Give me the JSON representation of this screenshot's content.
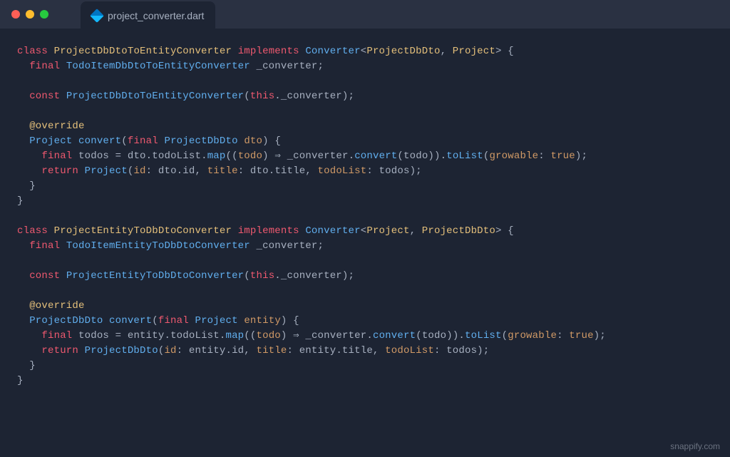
{
  "titlebar": {
    "filename": "project_converter.dart"
  },
  "code": {
    "line1_class": "class",
    "line1_name": "ProjectDbDtoToEntityConverter",
    "line1_impl": "implements",
    "line1_conv": "Converter",
    "line1_t1": "ProjectDbDto",
    "line1_t2": "Project",
    "line2_final": "final",
    "line2_type": "TodoItemDbDtoToEntityConverter",
    "line2_name": "_converter",
    "line4_const": "const",
    "line4_name": "ProjectDbDtoToEntityConverter",
    "line4_this": "this",
    "line4_field": "._converter",
    "line6_anno": "@override",
    "line7_ret": "Project",
    "line7_method": "convert",
    "line7_final": "final",
    "line7_ptype": "ProjectDbDto",
    "line7_pname": "dto",
    "line8_final": "final",
    "line8_var": "todos",
    "line8_dto": "dto",
    "line8_todolist": ".todoList.",
    "line8_map": "map",
    "line8_todo": "todo",
    "line8_arrow": "⇒",
    "line8_conv": "_converter.",
    "line8_convert": "convert",
    "line8_tolist": "toList",
    "line8_grow": "growable",
    "line8_true": "true",
    "line9_return": "return",
    "line9_proj": "Project",
    "line9_id": "id",
    "line9_dtoid": " dto.id, ",
    "line9_title": "title",
    "line9_dtotitle": " dto.title, ",
    "line9_todolist": "todoList",
    "line9_todos": " todos",
    "class2_name": "ProjectEntityToDbDtoConverter",
    "class2_t1": "Project",
    "class2_t2": "ProjectDbDto",
    "class2_conv_type": "TodoItemEntityToDbDtoConverter",
    "class2_ret": "ProjectDbDto",
    "class2_ptype": "Project",
    "class2_pname": "entity",
    "class2_entity": "entity",
    "class2_entid": " entity.id, ",
    "class2_enttitle": " entity.title, "
  },
  "watermark": "snappify.com"
}
